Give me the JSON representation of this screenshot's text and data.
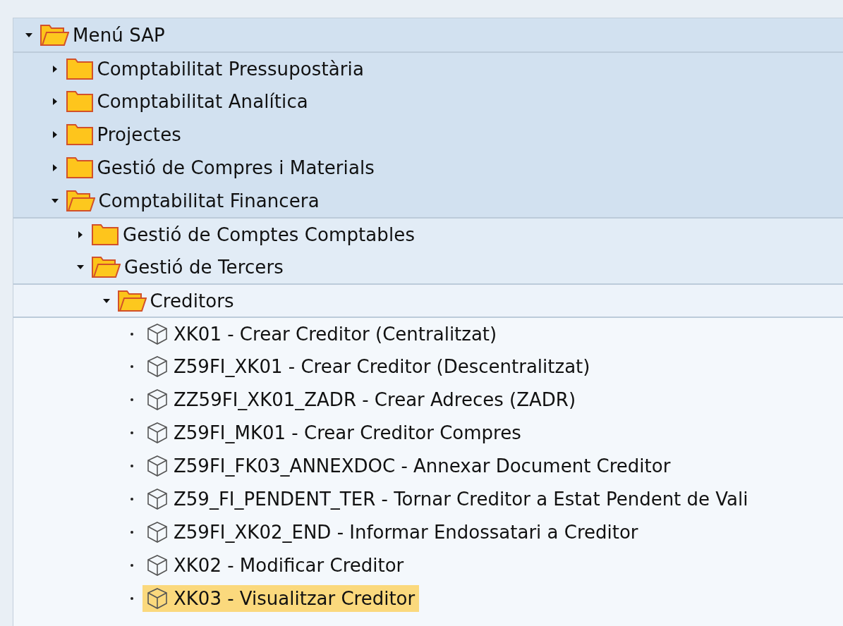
{
  "tree": [
    {
      "kind": "folder",
      "label": "Menú SAP",
      "expanded": true,
      "children": [
        {
          "kind": "folder",
          "label": "Comptabilitat Pressupostària",
          "expanded": false
        },
        {
          "kind": "folder",
          "label": "Comptabilitat Analítica",
          "expanded": false
        },
        {
          "kind": "folder",
          "label": "Projectes",
          "expanded": false
        },
        {
          "kind": "folder",
          "label": "Gestió de Compres i Materials",
          "expanded": false
        },
        {
          "kind": "folder",
          "label": "Comptabilitat Financera",
          "expanded": true,
          "children": [
            {
              "kind": "folder",
              "label": "Gestió de Comptes Comptables",
              "expanded": false
            },
            {
              "kind": "folder",
              "label": "Gestió de Tercers",
              "expanded": true,
              "children": [
                {
                  "kind": "folder",
                  "label": "Creditors",
                  "expanded": true,
                  "children": [
                    {
                      "kind": "transaction",
                      "label": "XK01 - Crear Creditor (Centralitzat)",
                      "selected": false
                    },
                    {
                      "kind": "transaction",
                      "label": "Z59FI_XK01 - Crear Creditor (Descentralitzat)",
                      "selected": false
                    },
                    {
                      "kind": "transaction",
                      "label": "ZZ59FI_XK01_ZADR - Crear Adreces (ZADR)",
                      "selected": false
                    },
                    {
                      "kind": "transaction",
                      "label": "Z59FI_MK01 - Crear Creditor Compres",
                      "selected": false
                    },
                    {
                      "kind": "transaction",
                      "label": "Z59FI_FK03_ANNEXDOC - Annexar Document Creditor",
                      "selected": false
                    },
                    {
                      "kind": "transaction",
                      "label": "Z59_FI_PENDENT_TER - Tornar Creditor a Estat Pendent de Vali",
                      "selected": false
                    },
                    {
                      "kind": "transaction",
                      "label": "Z59FI_XK02_END - Informar Endossatari a Creditor",
                      "selected": false
                    },
                    {
                      "kind": "transaction",
                      "label": "XK02 - Modificar Creditor",
                      "selected": false
                    },
                    {
                      "kind": "transaction",
                      "label": "XK03 - Visualitzar Creditor",
                      "selected": true
                    }
                  ]
                }
              ]
            }
          ]
        }
      ]
    }
  ]
}
